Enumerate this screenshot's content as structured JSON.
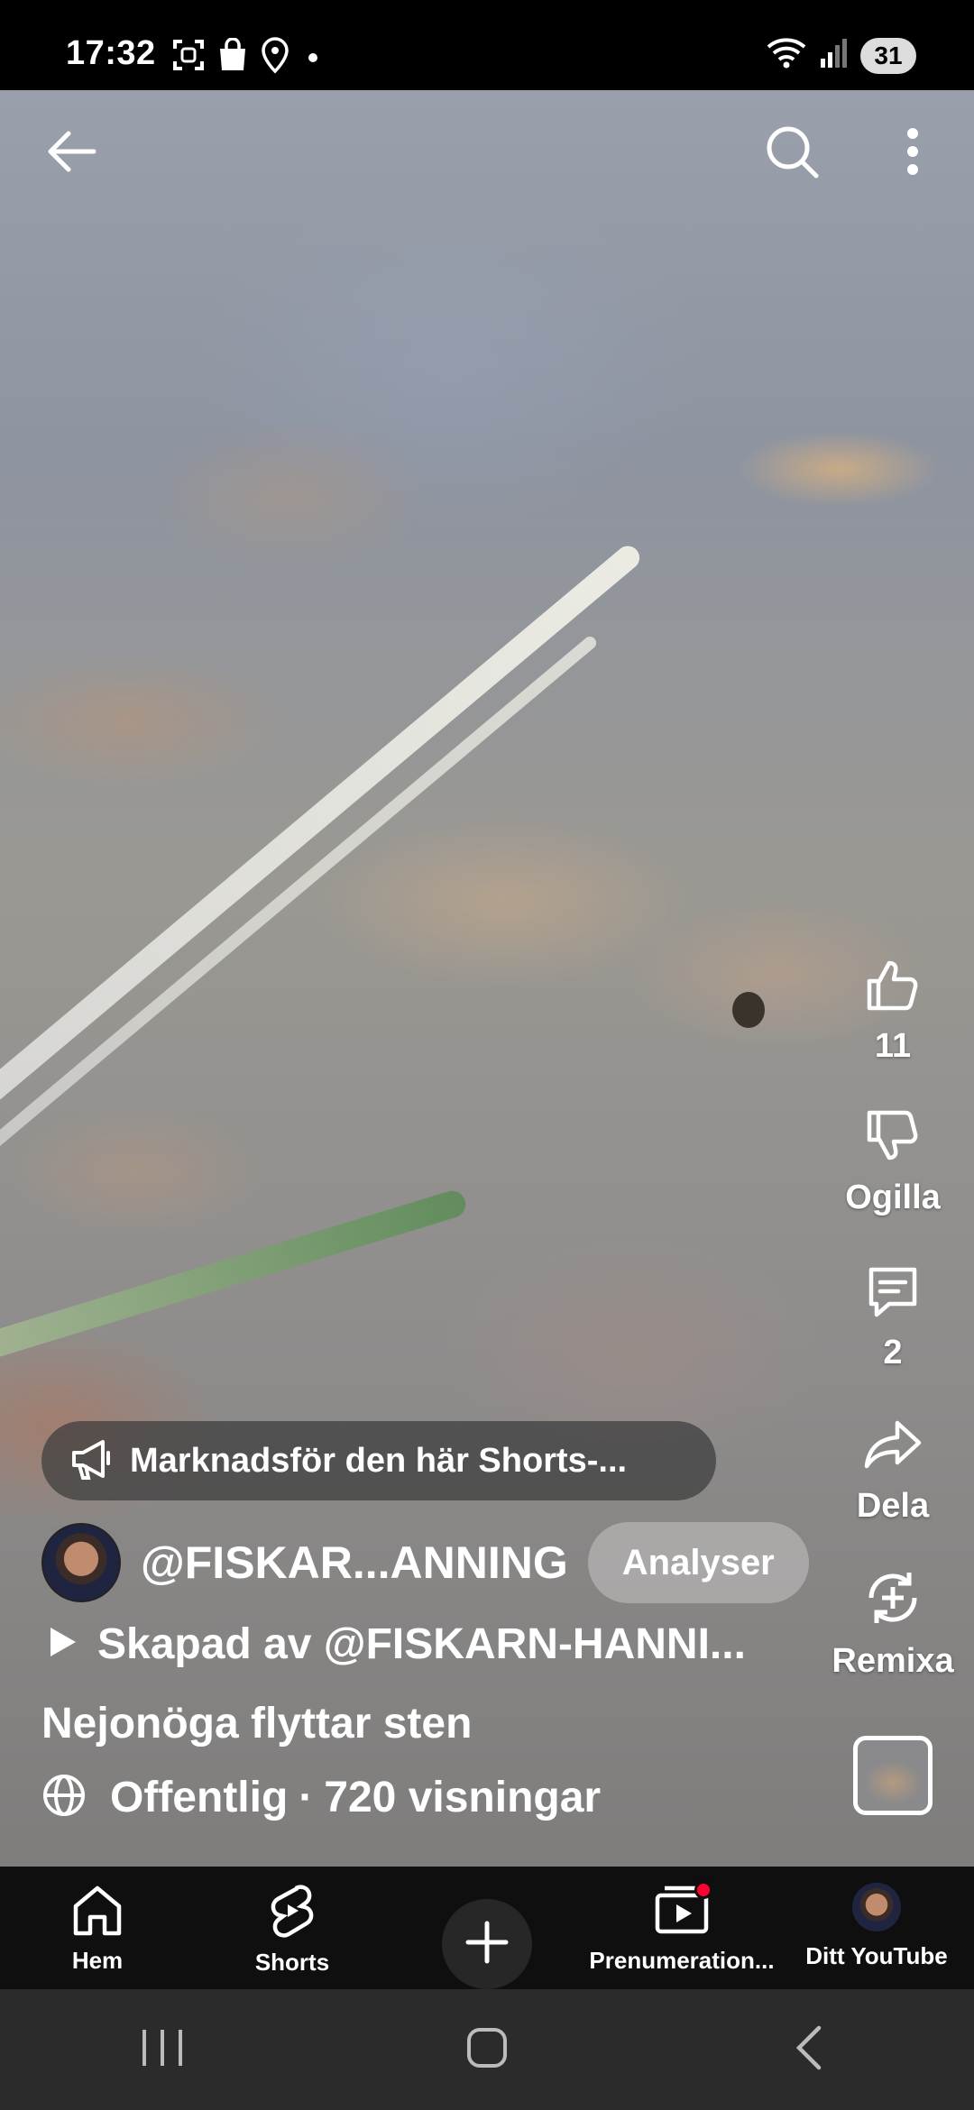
{
  "status_bar": {
    "time": "17:32",
    "battery": "31"
  },
  "video": {
    "promo_text": "Marknadsför den här Shorts-...",
    "channel_name": "@FISKAR...ANNING",
    "analyze_label": "Analyser",
    "created_by": "Skapad av @FISKARN-HANNI...",
    "title": "Nejonöga flyttar sten",
    "visibility": "Offentlig",
    "separator": "·",
    "views": "720 visningar"
  },
  "actions": {
    "like_count": "11",
    "dislike_label": "Ogilla",
    "comment_count": "2",
    "share_label": "Dela",
    "remix_label": "Remixa"
  },
  "nav": {
    "home": "Hem",
    "shorts": "Shorts",
    "subscriptions": "Prenumeration...",
    "you": "Ditt YouTube"
  },
  "colors": {
    "notification": "#ff0033",
    "nav_bg": "#0f0f0f"
  }
}
